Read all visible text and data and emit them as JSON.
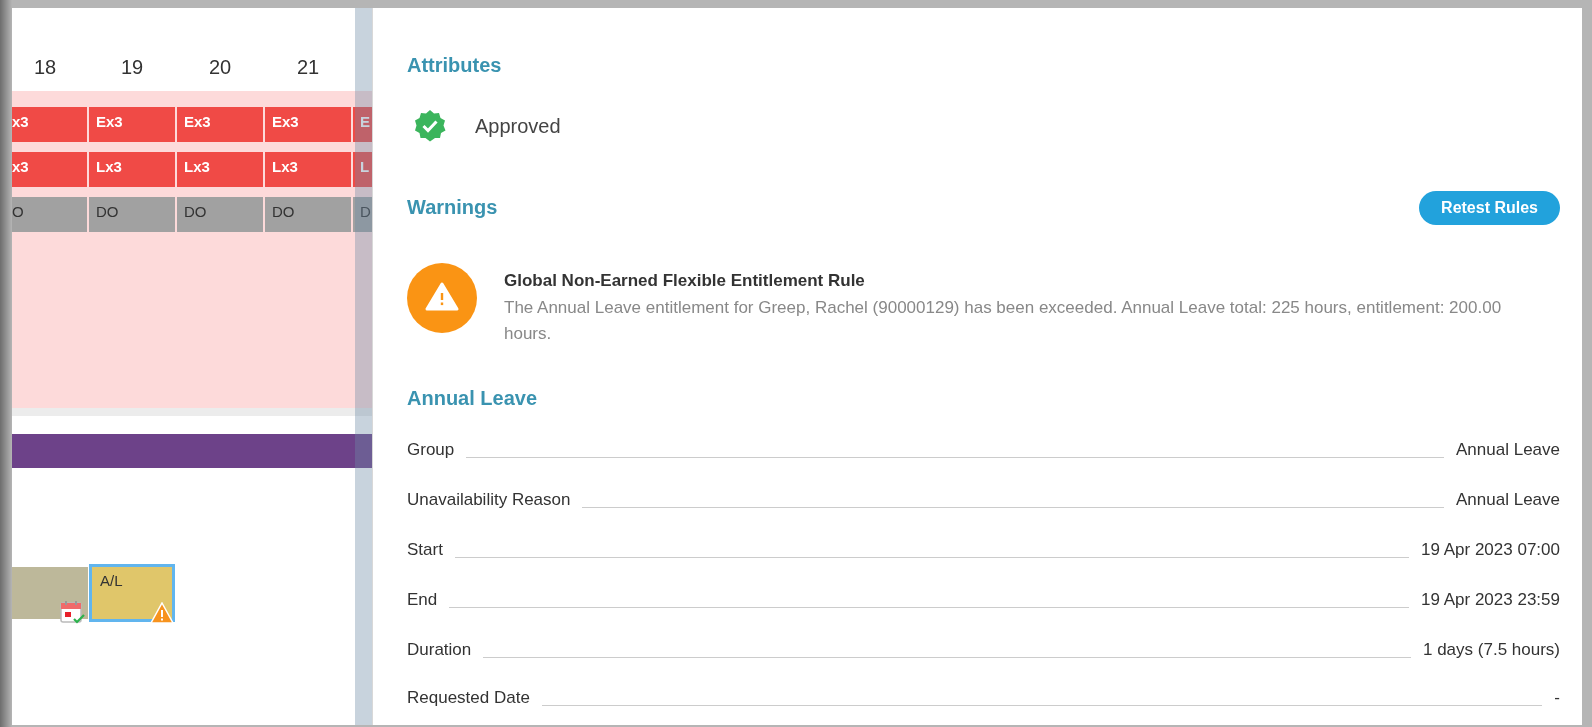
{
  "calendar": {
    "days": [
      "18",
      "19",
      "20",
      "21"
    ],
    "shift_rows": [
      {
        "kind": "early",
        "cells": [
          "x3",
          "Ex3",
          "Ex3",
          "Ex3",
          "E"
        ]
      },
      {
        "kind": "late",
        "cells": [
          "x3",
          "Lx3",
          "Lx3",
          "Lx3",
          "L"
        ]
      },
      {
        "kind": "day_off",
        "cells": [
          "O",
          "DO",
          "DO",
          "DO",
          "D"
        ]
      }
    ],
    "leave_blocks": [
      {
        "kind": "other",
        "selected": false
      },
      {
        "kind": "leave",
        "label": "A/L",
        "selected": true
      }
    ]
  },
  "attributes": {
    "heading": "Attributes",
    "status": "Approved"
  },
  "warnings": {
    "heading": "Warnings",
    "button": "Retest Rules",
    "items": [
      {
        "title": "Global Non-Earned Flexible Entitlement Rule",
        "message": "The Annual Leave entitlement for Greep, Rachel (90000129) has been exceeded. Annual Leave total: 225 hours, entitlement: 200.00 hours."
      }
    ]
  },
  "details": {
    "heading": "Annual Leave",
    "fields": [
      {
        "label": "Group",
        "value": "Annual Leave"
      },
      {
        "label": "Unavailability Reason",
        "value": "Annual Leave"
      },
      {
        "label": "Start",
        "value": "19 Apr 2023 07:00"
      },
      {
        "label": "End",
        "value": "19 Apr 2023 23:59"
      },
      {
        "label": "Duration",
        "value": "1 days (7.5 hours)"
      },
      {
        "label": "Requested Date",
        "value": "-"
      }
    ]
  }
}
